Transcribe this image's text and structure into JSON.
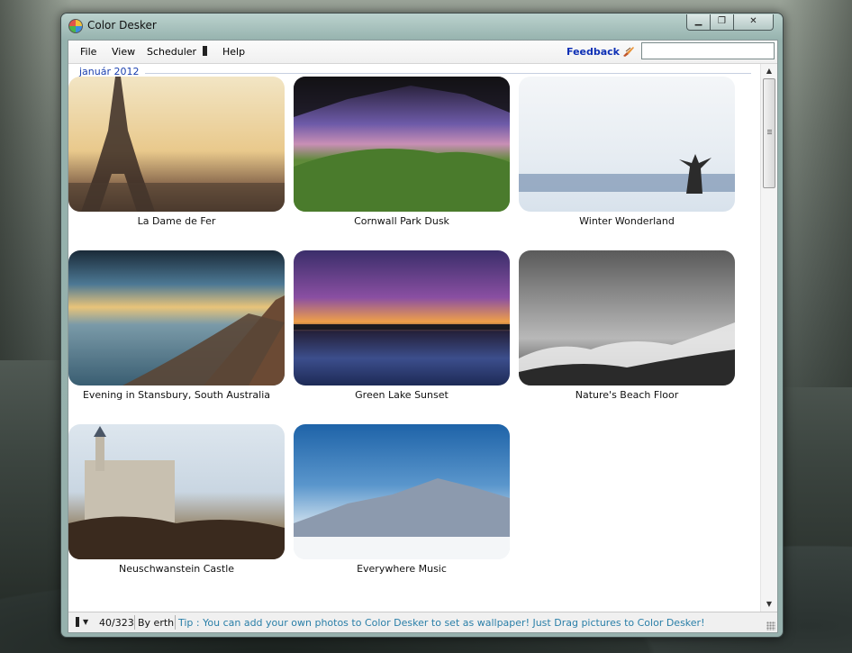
{
  "window": {
    "title": "Color Desker",
    "min_glyph": "▁",
    "max_glyph": "❐",
    "close_glyph": "✕"
  },
  "menu": {
    "file": "File",
    "view": "View",
    "scheduler": "Scheduler",
    "help": "Help",
    "feedback": "Feedback"
  },
  "search": {
    "value": "",
    "placeholder": ""
  },
  "group": {
    "label": "január 2012"
  },
  "wallpapers": [
    {
      "title": "La Dame de Fer"
    },
    {
      "title": "Cornwall Park Dusk"
    },
    {
      "title": "Winter Wonderland"
    },
    {
      "title": "Evening in Stansbury, South Australia"
    },
    {
      "title": "Green Lake Sunset"
    },
    {
      "title": "Nature's Beach Floor"
    },
    {
      "title": "Neuschwanstein Castle"
    },
    {
      "title": "Everywhere Music"
    }
  ],
  "scrollbar": {
    "up": "▲",
    "down": "▼"
  },
  "status": {
    "dropdown_glyph": "▼",
    "count": "40/323",
    "by": "By erth",
    "tip": "Tip : You can add your own photos to Color Desker to set as wallpaper! Just Drag pictures to Color Desker!"
  },
  "colors": {
    "accent": "#1a3fae",
    "feedback": "#0d2fb5",
    "tip": "#2a7fa8"
  }
}
